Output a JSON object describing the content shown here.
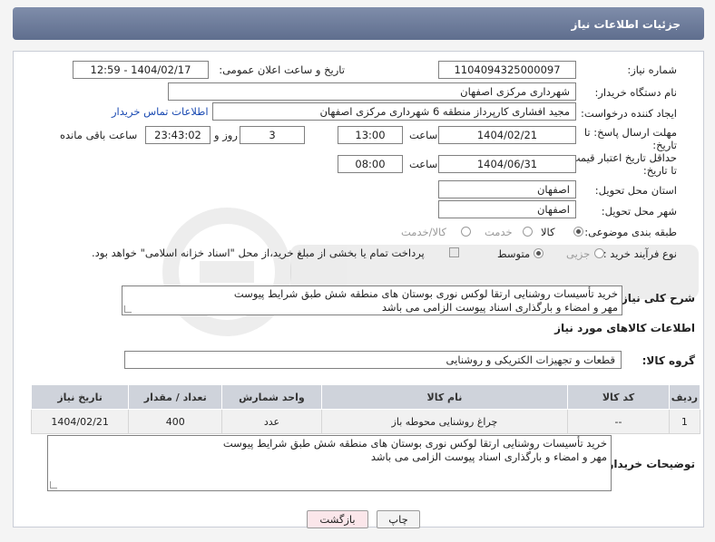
{
  "header": {
    "title": "جزئیات اطلاعات نیاز"
  },
  "form": {
    "need_number_label": "شماره نیاز:",
    "need_number": "1104094325000097",
    "announce_label": "تاریخ و ساعت اعلان عمومی:",
    "announce_value": "1404/02/17 - 12:59",
    "buyer_org_label": "نام دستگاه خریدار:",
    "buyer_org": "شهرداری مرکزی اصفهان",
    "creator_label": "ایجاد کننده درخواست:",
    "creator": "مجید افشاری کارپرداز منطقه 6 شهرداری مرکزی اصفهان",
    "contact_link": "اطلاعات تماس خریدار",
    "reply_deadline_label_1": "مهلت ارسال پاسخ: تا",
    "reply_deadline_label_2": "تاریخ:",
    "reply_date": "1404/02/21",
    "time_label": "ساعت",
    "reply_time": "13:00",
    "days_value": "3",
    "days_label": "روز و",
    "remaining_time": "23:43:02",
    "remaining_label": "ساعت باقی مانده",
    "price_validity_label_1": "حداقل تاریخ اعتبار قیمت:",
    "price_validity_label_2": "تا تاریخ:",
    "price_date": "1404/06/31",
    "price_time": "08:00",
    "province_label": "استان محل تحویل:",
    "province": "اصفهان",
    "city_label": "شهر محل تحویل:",
    "city": "اصفهان",
    "category_label": "طبقه بندی موضوعی:",
    "category_options": [
      "کالا",
      "خدمت",
      "کالا/خدمت"
    ],
    "process_label": "نوع فرآیند خرید :",
    "process_options": [
      "جزیی",
      "متوسط"
    ],
    "payment_note": "پرداخت تمام یا بخشی از مبلغ خرید،از محل \"اسناد خزانه اسلامی\" خواهد بود."
  },
  "description": {
    "label": "شرح کلی نیاز:",
    "line1": "خرید تأسیسات روشنایی ارتقا لوکس نوری بوستان های منطقه شش طبق شرایط پیوست",
    "line2": "مهر و امضاء و بارگذاری اسناد پیوست الزامی می باشد"
  },
  "goods_section": {
    "title": "اطلاعات کالاهای مورد نیاز",
    "group_label": "گروه کالا:",
    "group_value": "قطعات و تجهیزات الکتریکی و روشنایی"
  },
  "table": {
    "headers": [
      "ردیف",
      "کد کالا",
      "نام کالا",
      "واحد شمارش",
      "تعداد / مقدار",
      "تاریخ نیاز"
    ],
    "rows": [
      [
        "1",
        "--",
        "چراغ روشنایی محوطه باز",
        "عدد",
        "400",
        "1404/02/21"
      ]
    ]
  },
  "buyer_notes": {
    "label": "توضیحات خریدار:",
    "line1": "خرید تأسیسات روشنایی ارتقا لوکس نوری بوستان های منطقه شش طبق شرایط پیوست",
    "line2": "مهر و امضاء و بارگذاری اسناد پیوست الزامی می باشد"
  },
  "buttons": {
    "print": "چاپ",
    "back": "بازگشت"
  },
  "colors": {
    "header": "#6f7d9c",
    "link": "#1a4ab2",
    "back_button": "#fbe6ea"
  }
}
